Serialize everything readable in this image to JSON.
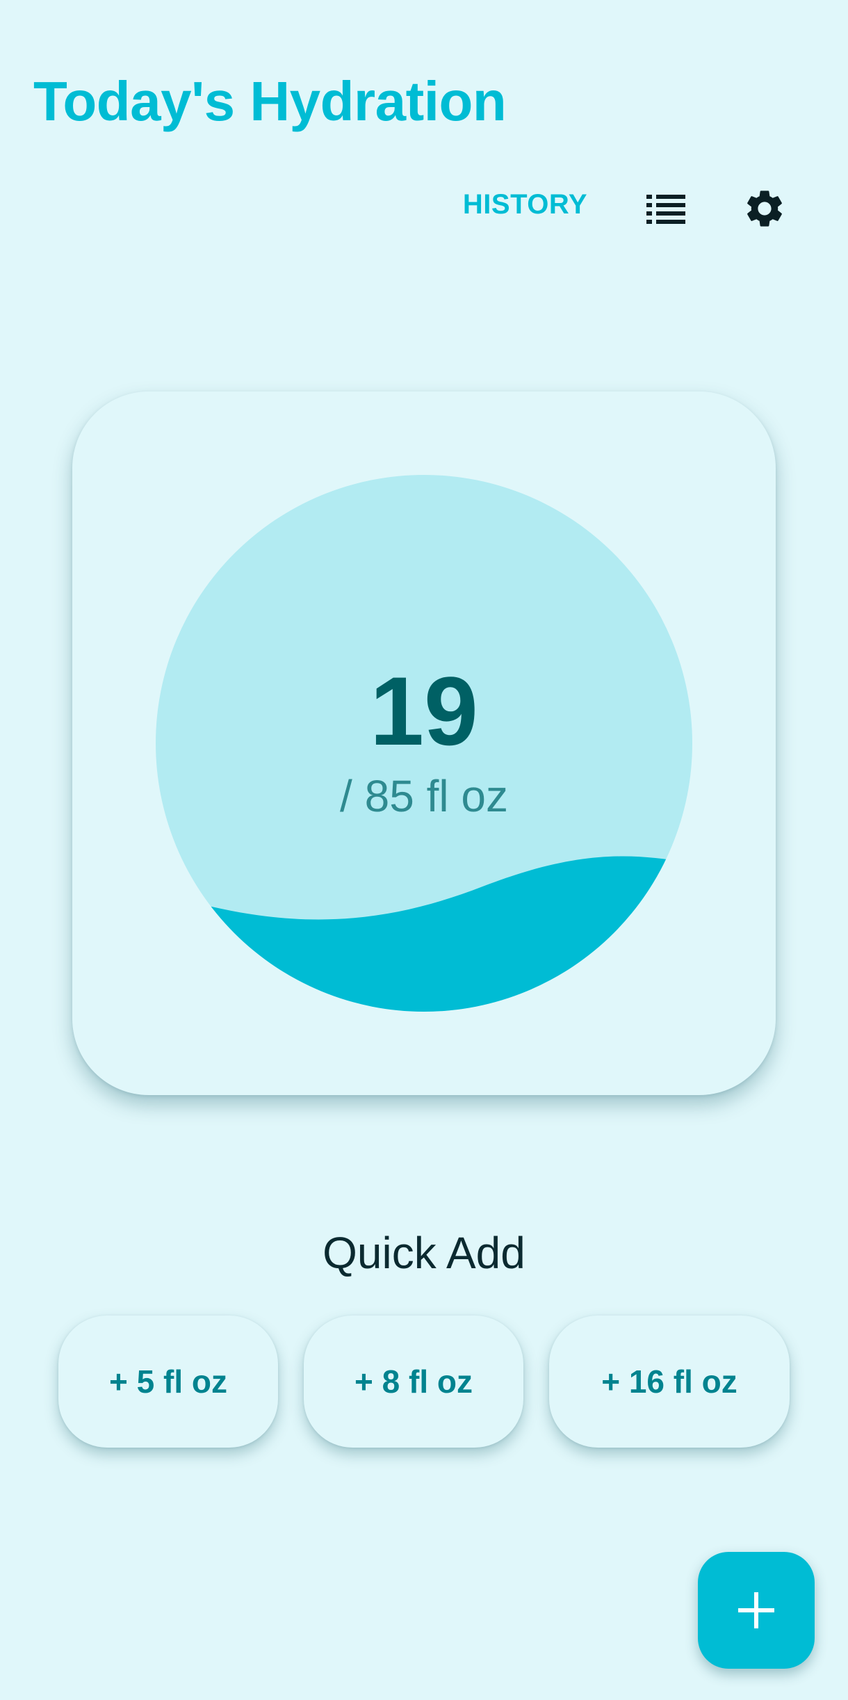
{
  "header": {
    "title": "Today's Hydration",
    "history_label": "HISTORY",
    "list_icon": "list-icon",
    "settings_icon": "gear-icon"
  },
  "progress": {
    "consumed": "19",
    "goal_text": "/ 85 fl oz",
    "fill_fraction": 0.22
  },
  "quick_add": {
    "title": "Quick Add",
    "options": [
      {
        "label": "+ 5 fl oz"
      },
      {
        "label": "+ 8 fl oz"
      },
      {
        "label": "+ 16 fl oz"
      }
    ]
  },
  "fab": {
    "icon": "plus-icon"
  },
  "colors": {
    "background": "#E0F7FA",
    "accent": "#00BCD4",
    "gauge_bg": "#B2EBF2",
    "value_text": "#006064",
    "chip_text": "#00838F"
  }
}
